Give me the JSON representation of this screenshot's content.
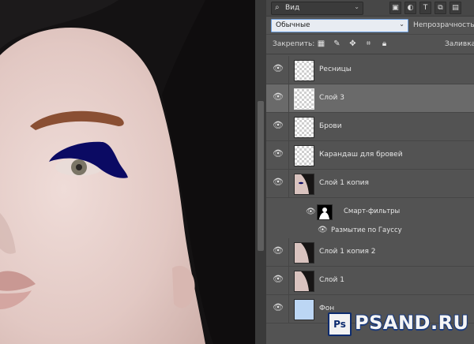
{
  "panel": {
    "kind_filter": "Вид",
    "blend_mode": "Обычные",
    "opacity_label": "Непрозрачность:",
    "lock_label": "Закрепить:",
    "fill_label": "Заливка:"
  },
  "layers": [
    {
      "name": "Ресницы",
      "selected": false
    },
    {
      "name": "Слой 3",
      "selected": true
    },
    {
      "name": "Брови",
      "selected": false
    },
    {
      "name": "Карандаш для бровей",
      "selected": false
    },
    {
      "name": "Слой 1 копия",
      "selected": false
    },
    {
      "name": "Слой 1 копия 2",
      "selected": false
    },
    {
      "name": "Слой 1",
      "selected": false
    },
    {
      "name": "Фон",
      "selected": false
    }
  ],
  "smart_filters": {
    "label": "Смарт-фильтры",
    "filter_name": "Размытие по Гауссу"
  },
  "watermark": {
    "badge": "Ps",
    "text": "PSAND.RU"
  },
  "colors": {
    "panel_bg": "#535353",
    "selected_row": "#6a6a6a",
    "blend_select_bg": "#e8ecf2",
    "eyeliner": "#0b0a63"
  }
}
